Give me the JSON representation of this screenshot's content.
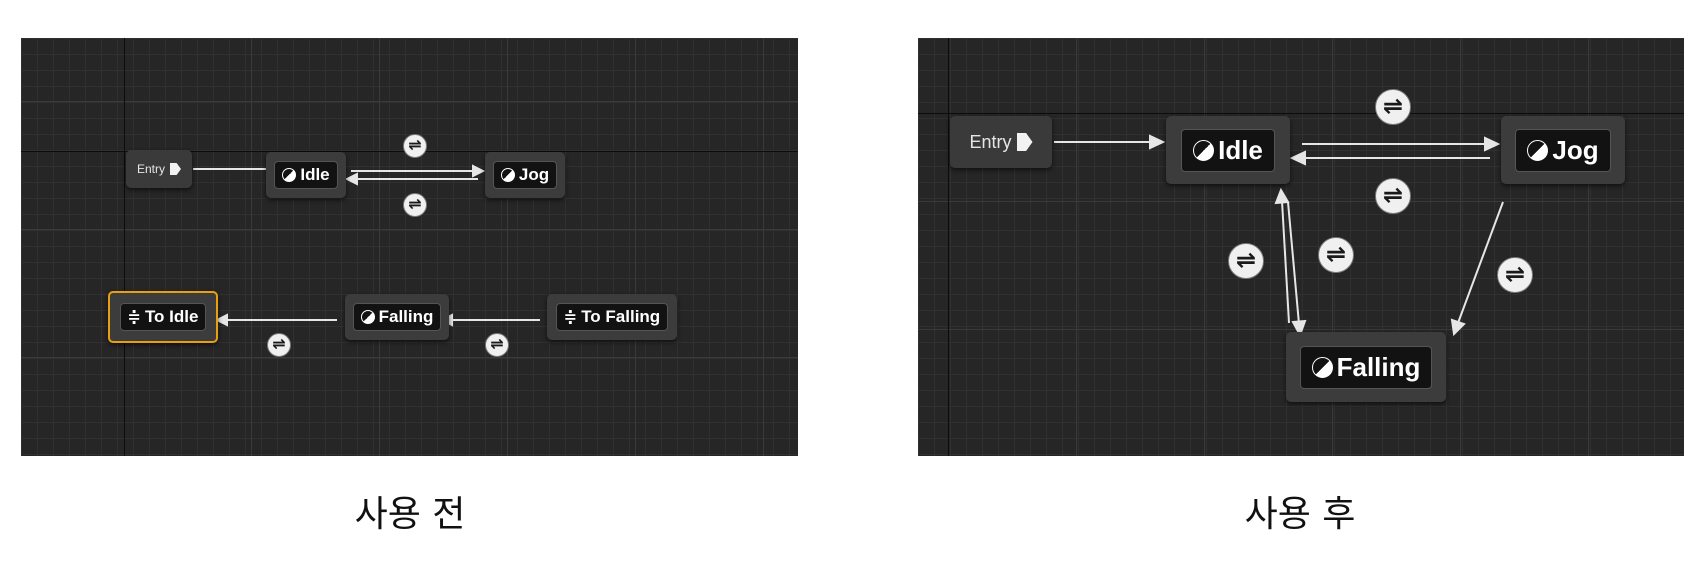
{
  "before": {
    "caption": "사용 전",
    "entry_label": "Entry",
    "states": {
      "idle": "Idle",
      "jog": "Jog",
      "falling": "Falling",
      "to_idle": "To Idle",
      "to_falling": "To Falling"
    },
    "selected_node": "To Idle",
    "transition_icon": "transition-rule-icon",
    "state_icon": "state-machine-state-icon",
    "conduit_icon": "conduit-icon",
    "conduit_glyph": "≑",
    "selection_color": "#e8a010"
  },
  "after": {
    "caption": "사용 후",
    "entry_label": "Entry",
    "states": {
      "idle": "Idle",
      "jog": "Jog",
      "falling": "Falling"
    },
    "transition_icon": "transition-rule-icon",
    "state_icon": "state-machine-state-icon"
  },
  "transition_glyph": "⇌"
}
